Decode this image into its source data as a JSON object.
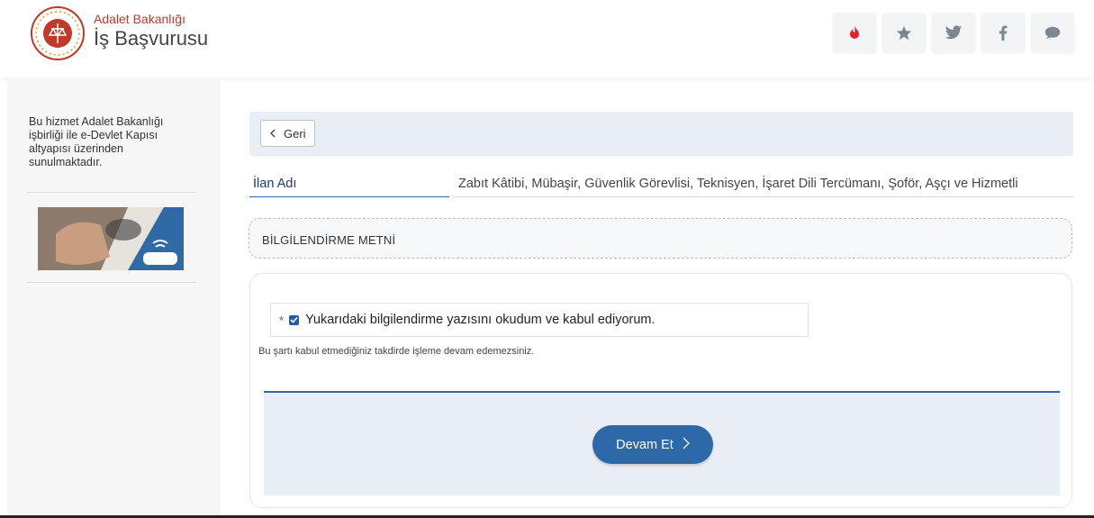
{
  "header": {
    "org_name": "Adalet Bakanlığı",
    "app_name": "İş Başvurusu",
    "icons": [
      "fire-icon",
      "star-icon",
      "twitter-icon",
      "facebook-icon",
      "chat-icon"
    ],
    "colors": {
      "fire": "#e8202b",
      "icon": "#9aa3ad"
    }
  },
  "sidebar": {
    "notice": "Bu hizmet Adalet Bakanlığı işbirliği ile e-Devlet Kapısı altyapısı üzerinden sunulmaktadır."
  },
  "back": {
    "label": "Geri"
  },
  "ilan": {
    "label": "İlan Adı",
    "value": "Zabıt Kâtibi, Mübaşir, Güvenlik Görevlisi, Teknisyen, İşaret Dili Tercümanı, Şoför, Aşçı ve Hizmetli"
  },
  "info": {
    "title": "BİLGİLENDİRME METNİ"
  },
  "consent": {
    "required_mark": "*",
    "checked": true,
    "label": "Yukarıdaki bilgilendirme yazısını okudum ve kabul ediyorum.",
    "warning": "Bu şartı kabul etmediğiniz takdirde işleme devam edemezsiniz."
  },
  "actions": {
    "continue_label": "Devam Et"
  }
}
